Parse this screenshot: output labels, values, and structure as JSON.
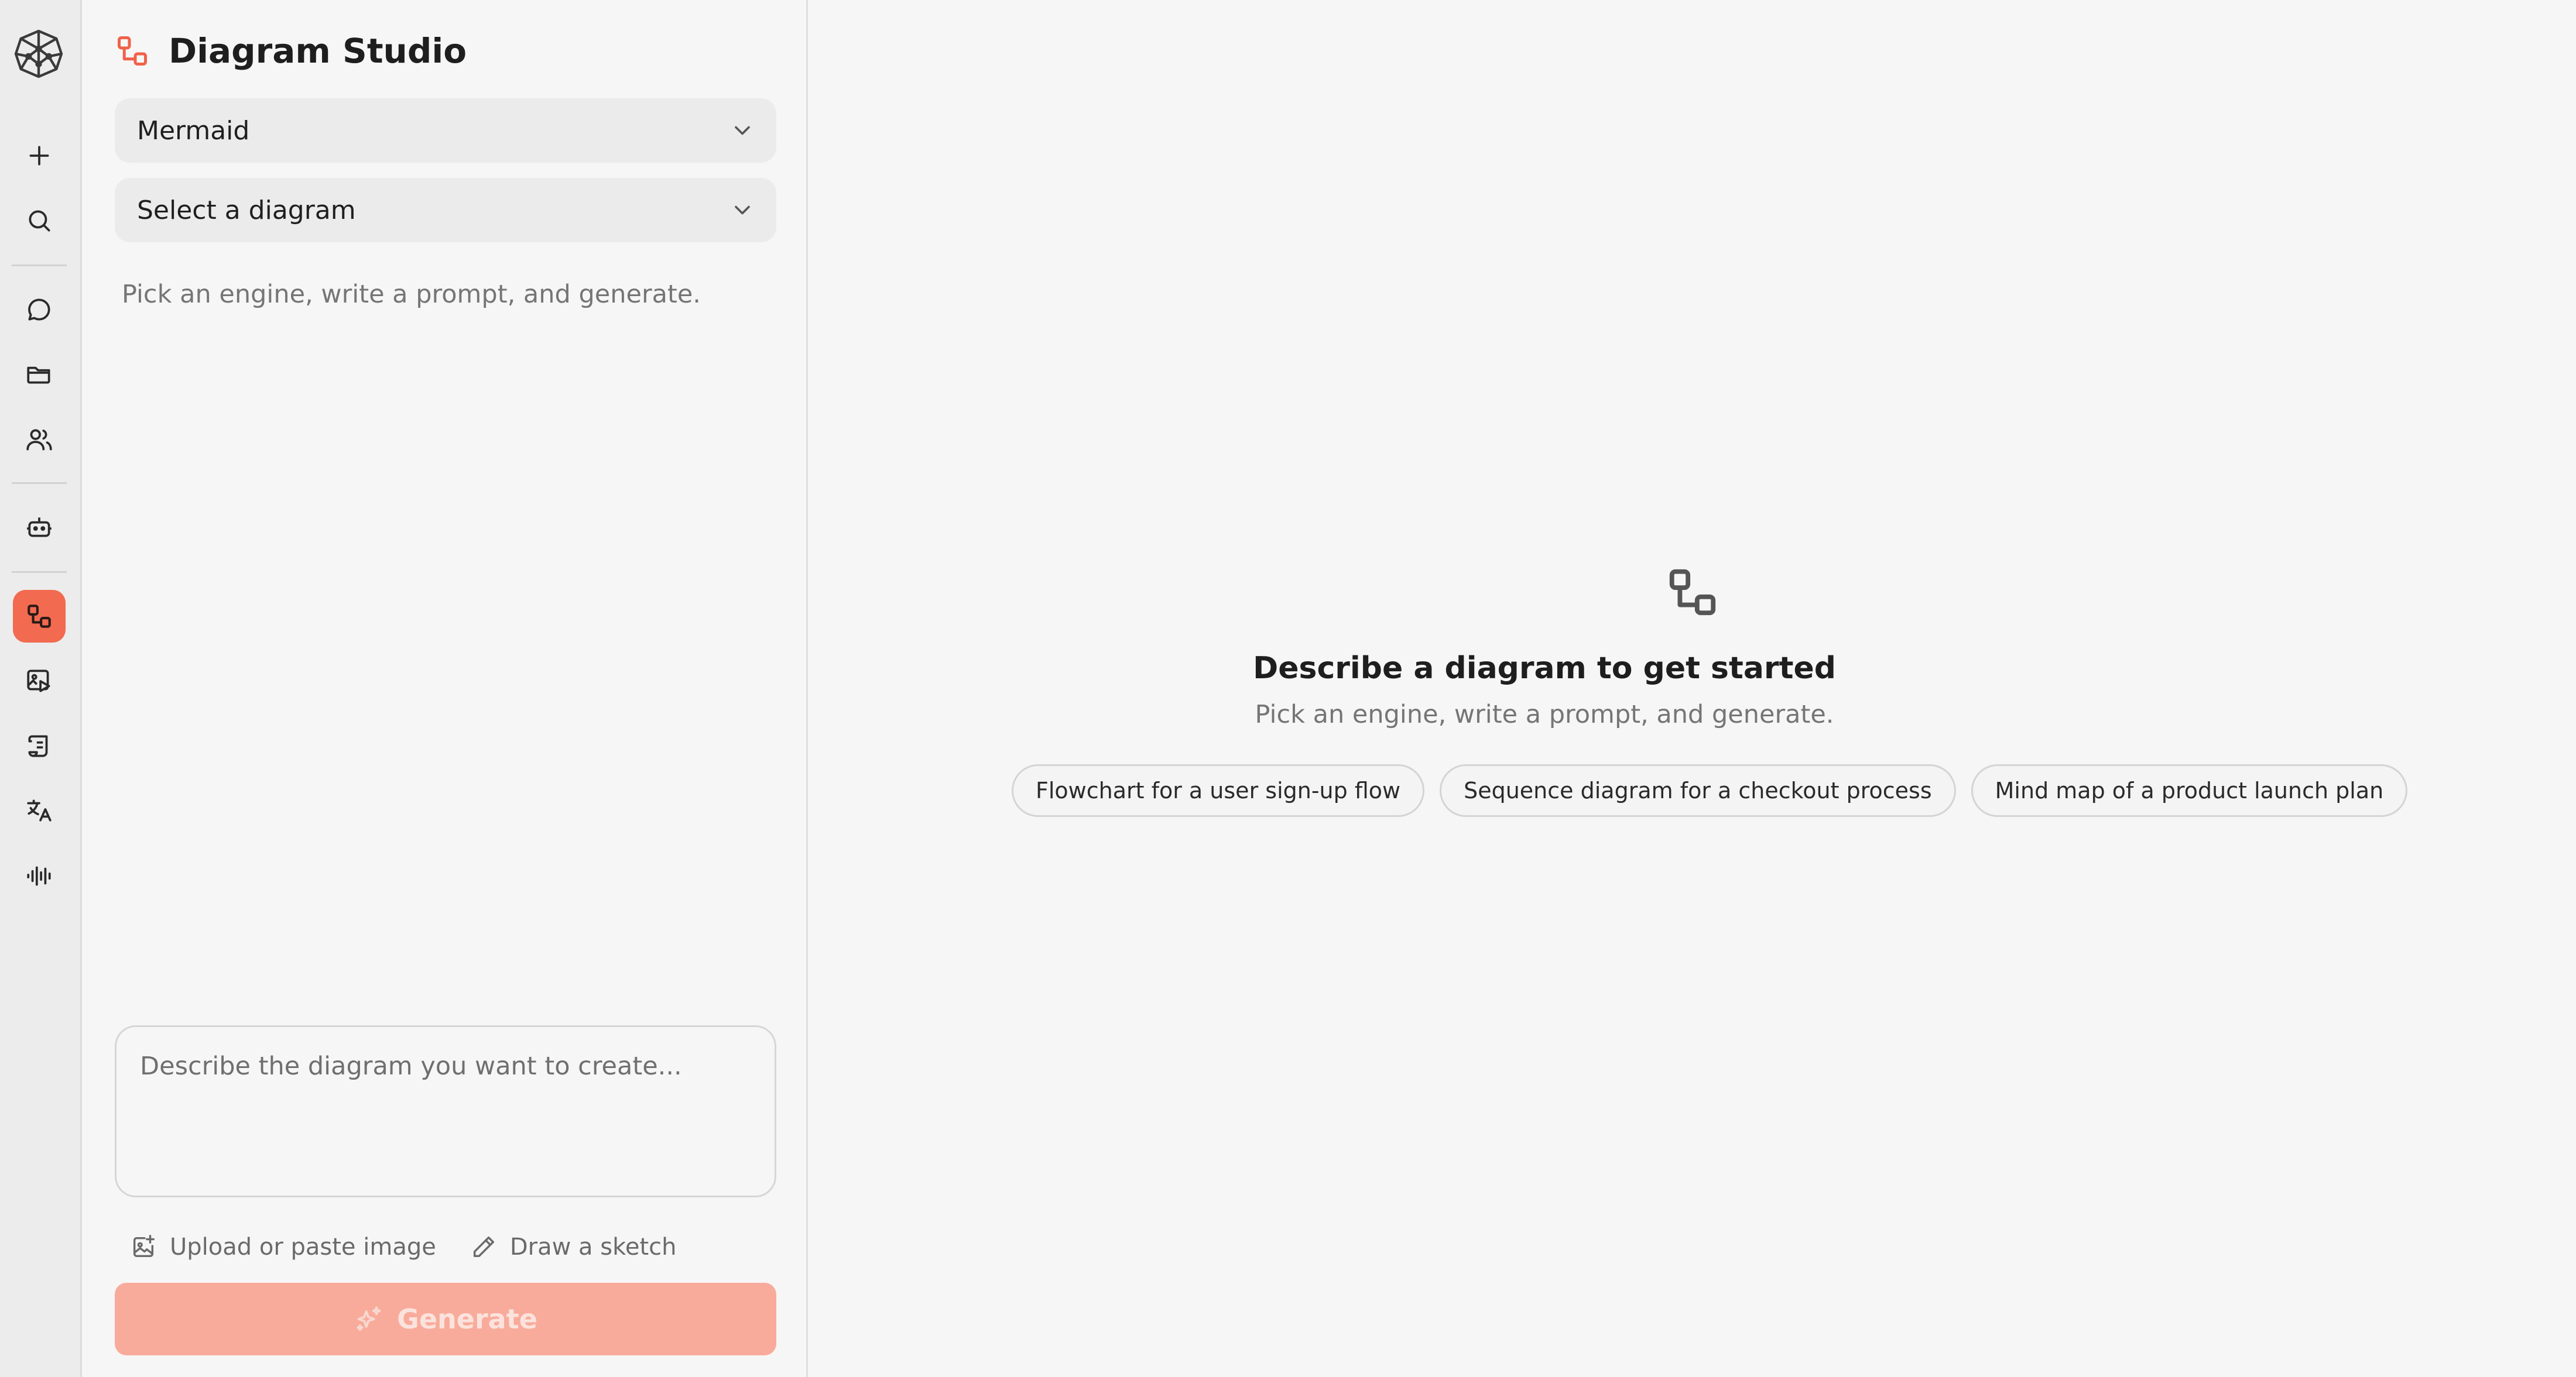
{
  "rail": {
    "items": [
      {
        "name": "new",
        "icon": "plus-icon"
      },
      {
        "name": "search",
        "icon": "search-icon"
      },
      {
        "name": "chat",
        "icon": "chat-bubble-icon"
      },
      {
        "name": "files",
        "icon": "folder-icon"
      },
      {
        "name": "team",
        "icon": "users-icon"
      },
      {
        "name": "bot",
        "icon": "robot-icon"
      },
      {
        "name": "diagram",
        "icon": "diagram-icon",
        "active": true
      },
      {
        "name": "image-video",
        "icon": "image-play-icon"
      },
      {
        "name": "scripts",
        "icon": "scroll-icon"
      },
      {
        "name": "translate",
        "icon": "translate-icon"
      },
      {
        "name": "audio",
        "icon": "waveform-icon"
      }
    ],
    "active_color": "#f26a4f"
  },
  "panel": {
    "title": "Diagram Studio",
    "engine_select": {
      "value": "Mermaid"
    },
    "diagram_select": {
      "value": "Select a diagram"
    },
    "hint": "Pick an engine, write a prompt, and generate.",
    "prompt": {
      "placeholder": "Describe the diagram you want to create...",
      "value": ""
    },
    "upload_label": "Upload or paste image",
    "sketch_label": "Draw a sketch",
    "generate_label": "Generate"
  },
  "main": {
    "empty_title": "Describe a diagram to get started",
    "empty_subtitle": "Pick an engine, write a prompt, and generate.",
    "suggestions": [
      "Flowchart for a user sign-up flow",
      "Sequence diagram for a checkout process",
      "Mind map of a product launch plan"
    ]
  },
  "colors": {
    "accent": "#f0614a",
    "generate_disabled": "#f9ab9b",
    "background": "#f6f6f6"
  }
}
